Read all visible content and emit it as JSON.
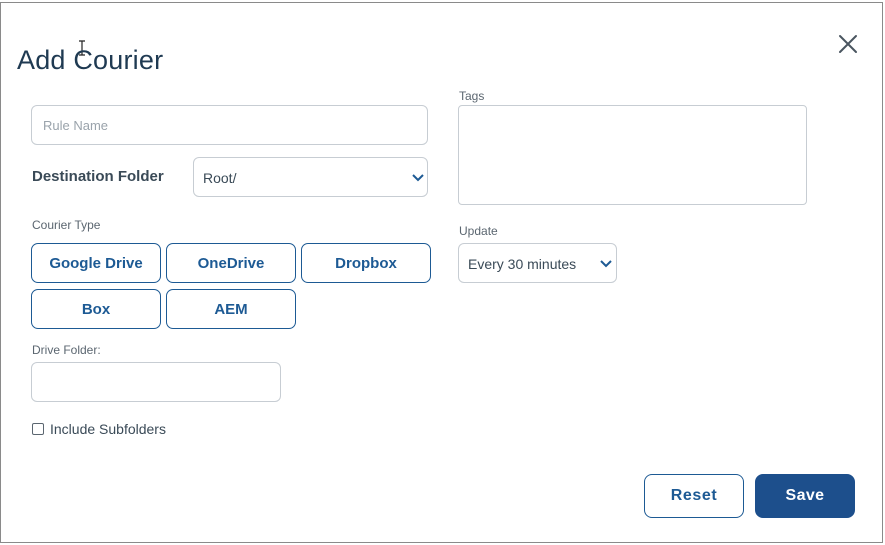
{
  "dialog": {
    "title": "Add Courier",
    "close_icon": "close-icon"
  },
  "form": {
    "rule_name": {
      "placeholder": "Rule Name",
      "value": ""
    },
    "destination_folder": {
      "label": "Destination Folder",
      "value": "Root/"
    },
    "courier_type": {
      "label": "Courier Type",
      "options": [
        "Google Drive",
        "OneDrive",
        "Dropbox",
        "Box",
        "AEM"
      ]
    },
    "drive_folder": {
      "label": "Drive Folder:",
      "value": ""
    },
    "include_subfolders": {
      "label": "Include Subfolders",
      "checked": false
    },
    "tags": {
      "label": "Tags",
      "value": ""
    },
    "update": {
      "label": "Update",
      "value": "Every 30 minutes"
    }
  },
  "actions": {
    "reset_label": "Reset",
    "save_label": "Save"
  },
  "colors": {
    "accent": "#1d5a94",
    "primary_button": "#1d4f8c",
    "title": "#1f3a52"
  }
}
